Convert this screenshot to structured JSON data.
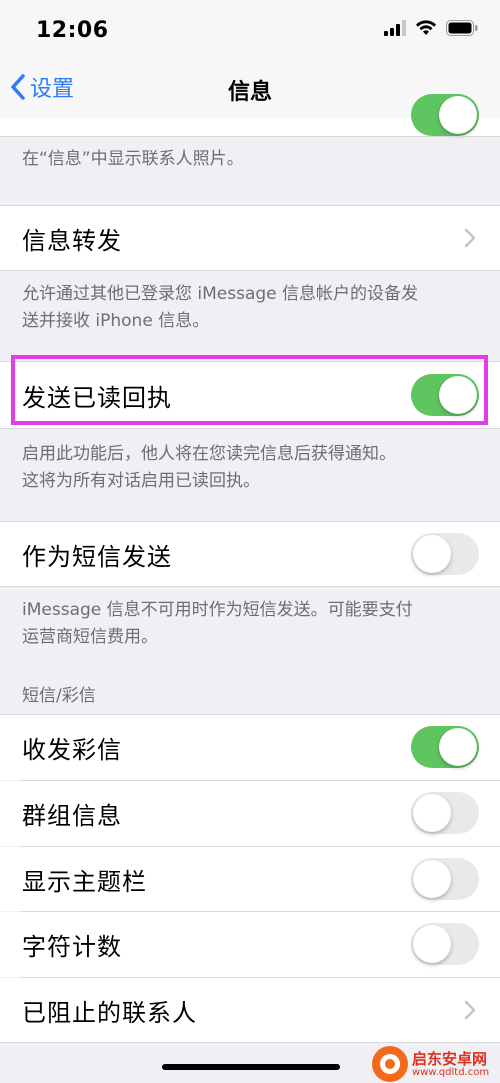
{
  "status_bar": {
    "time": "12:06"
  },
  "nav": {
    "back_label": "设置",
    "title": "信息"
  },
  "sections": {
    "contact_photos_footer": "在“信息”中显示联系人照片。",
    "forwarding": {
      "label": "信息转发",
      "footer_line1": "允许通过其他已登录您 iMessage 信息帐户的设备发",
      "footer_line2": "送并接收 iPhone 信息。"
    },
    "read_receipts": {
      "label": "发送已读回执",
      "toggle_on": true,
      "footer_line1": "启用此功能后，他人将在您读完信息后获得通知。",
      "footer_line2": "这将为所有对话启用已读回执。"
    },
    "send_as_sms": {
      "label": "作为短信发送",
      "toggle_on": false,
      "footer_line1": "iMessage 信息不可用时作为短信发送。可能要支付",
      "footer_line2": "运营商短信费用。"
    },
    "sms_mms": {
      "header": "短信/彩信",
      "items": [
        {
          "label": "收发彩信",
          "toggle_on": true
        },
        {
          "label": "群组信息",
          "toggle_on": false
        },
        {
          "label": "显示主题栏",
          "toggle_on": false
        },
        {
          "label": "字符计数",
          "toggle_on": false
        },
        {
          "label": "已阻止的联系人"
        }
      ]
    }
  },
  "watermark": {
    "title": "启东安卓网",
    "url": "www.qdltd.com"
  },
  "colors": {
    "accent": "#2f7cf6",
    "toggle_on": "#5ec560",
    "highlight": "#e33be6"
  }
}
